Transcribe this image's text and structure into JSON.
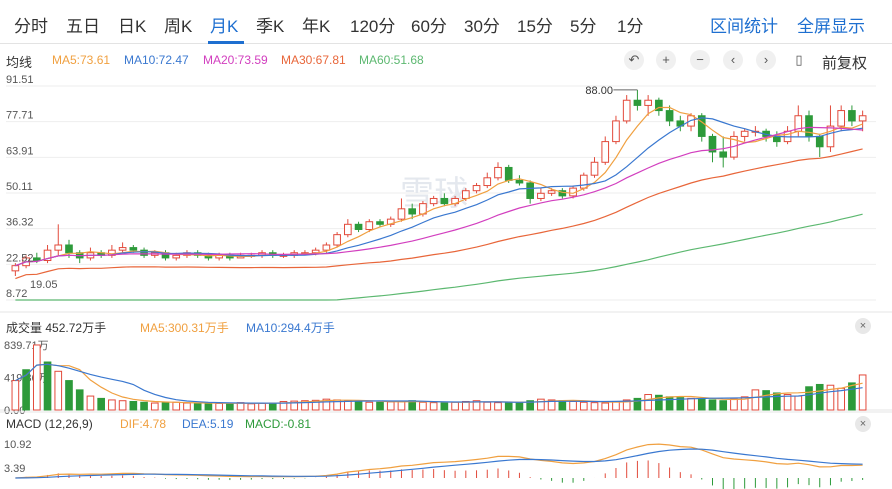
{
  "tabs": [
    "分时",
    "五日",
    "日K",
    "周K",
    "月K",
    "季K",
    "年K",
    "120分",
    "60分",
    "30分",
    "15分",
    "5分",
    "1分"
  ],
  "active_tab": "月K",
  "right_links": {
    "stats": "区间统计",
    "fullscreen": "全屏显示"
  },
  "toolbar": {
    "adjust": "前复权"
  },
  "ma_legend": {
    "title": "均线",
    "ma5": "MA5:73.61",
    "ma10": "MA10:72.47",
    "ma20": "MA20:73.59",
    "ma30": "MA30:67.81",
    "ma60": "MA60:51.68"
  },
  "volume_legend": {
    "title": "成交量",
    "value": "452.72万手",
    "ma5": "MA5:300.31万手",
    "ma10": "MA10:294.4万手"
  },
  "macd_legend": {
    "title": "MACD (12,26,9)",
    "dif": "DIF:4.78",
    "dea": "DEA:5.19",
    "macd": "MACD:-0.81"
  },
  "watermark": "雪球",
  "colors": {
    "up": "#e24a3b",
    "down": "#2d9a3a",
    "accent": "#1e6fd0",
    "ma5": "#f0a040",
    "ma10": "#3a78d0",
    "ma20": "#d23fbf",
    "ma30": "#e8663a",
    "ma60": "#5cb870"
  },
  "chart_data": [
    {
      "type": "candlestick",
      "title": "",
      "y_ticks": [
        "91.51",
        "77.71",
        "63.91",
        "50.11",
        "36.32",
        "22.52",
        "8.72"
      ],
      "ylim": [
        8.72,
        91.51
      ],
      "annotations": {
        "max": "88.00",
        "min": "19.05"
      },
      "candles": [
        [
          20,
          22,
          18,
          23
        ],
        [
          22,
          25,
          21,
          26
        ],
        [
          25,
          24,
          23,
          27
        ],
        [
          24,
          28,
          23,
          30
        ],
        [
          28,
          30,
          26,
          38
        ],
        [
          30,
          27,
          25,
          32
        ],
        [
          27,
          25,
          23,
          28
        ],
        [
          25,
          27,
          24,
          29
        ],
        [
          27,
          26,
          25,
          28
        ],
        [
          26,
          28,
          25,
          30
        ],
        [
          28,
          29,
          27,
          31
        ],
        [
          29,
          28,
          27,
          30
        ],
        [
          28,
          26,
          25,
          29
        ],
        [
          26,
          27,
          25,
          28
        ],
        [
          27,
          25,
          24,
          28
        ],
        [
          25,
          26,
          24,
          27
        ],
        [
          26,
          27,
          25,
          28
        ],
        [
          27,
          26,
          25,
          28
        ],
        [
          26,
          25,
          24,
          27
        ],
        [
          25,
          26,
          24,
          27
        ],
        [
          26,
          25,
          24,
          27
        ],
        [
          25,
          26,
          25,
          27
        ],
        [
          26,
          26,
          25,
          27
        ],
        [
          26,
          27,
          25,
          28
        ],
        [
          27,
          26,
          25,
          28
        ],
        [
          26,
          26,
          25,
          27
        ],
        [
          26,
          27,
          25,
          28
        ],
        [
          27,
          27,
          26,
          28
        ],
        [
          27,
          28,
          26,
          29
        ],
        [
          28,
          30,
          27,
          31
        ],
        [
          30,
          34,
          29,
          35
        ],
        [
          34,
          38,
          33,
          40
        ],
        [
          38,
          36,
          35,
          39
        ],
        [
          36,
          39,
          35,
          40
        ],
        [
          39,
          38,
          37,
          40
        ],
        [
          38,
          40,
          37,
          41
        ],
        [
          40,
          44,
          39,
          48
        ],
        [
          44,
          42,
          40,
          46
        ],
        [
          42,
          46,
          41,
          47
        ],
        [
          46,
          48,
          45,
          49
        ],
        [
          48,
          46,
          45,
          50
        ],
        [
          46,
          48,
          45,
          49
        ],
        [
          48,
          51,
          47,
          52
        ],
        [
          51,
          53,
          50,
          54
        ],
        [
          53,
          56,
          52,
          58
        ],
        [
          56,
          60,
          55,
          62
        ],
        [
          60,
          55,
          54,
          61
        ],
        [
          55,
          54,
          53,
          57
        ],
        [
          54,
          48,
          46,
          55
        ],
        [
          48,
          50,
          47,
          52
        ],
        [
          50,
          51,
          49,
          52
        ],
        [
          51,
          49,
          48,
          52
        ],
        [
          49,
          52,
          48,
          53
        ],
        [
          52,
          57,
          51,
          58
        ],
        [
          57,
          62,
          56,
          64
        ],
        [
          62,
          70,
          61,
          72
        ],
        [
          70,
          78,
          69,
          80
        ],
        [
          78,
          86,
          77,
          88
        ],
        [
          86,
          84,
          82,
          90
        ],
        [
          84,
          86,
          80,
          88
        ],
        [
          86,
          82,
          80,
          87
        ],
        [
          82,
          78,
          76,
          84
        ],
        [
          78,
          76,
          74,
          80
        ],
        [
          76,
          80,
          74,
          81
        ],
        [
          80,
          72,
          70,
          81
        ],
        [
          72,
          66,
          62,
          73
        ],
        [
          66,
          64,
          60,
          72
        ],
        [
          64,
          72,
          63,
          74
        ],
        [
          72,
          74,
          70,
          75
        ],
        [
          74,
          74,
          72,
          76
        ],
        [
          74,
          72,
          70,
          75
        ],
        [
          72,
          70,
          68,
          74
        ],
        [
          70,
          74,
          69,
          76
        ],
        [
          74,
          80,
          72,
          84
        ],
        [
          80,
          72,
          70,
          82
        ],
        [
          72,
          68,
          64,
          73
        ],
        [
          68,
          76,
          66,
          84
        ],
        [
          76,
          82,
          74,
          84
        ],
        [
          82,
          78,
          76,
          84
        ],
        [
          78,
          80,
          74,
          82
        ]
      ]
    },
    {
      "type": "bar",
      "title": "",
      "y_ticks": [
        "839.71万",
        "419.86万",
        "0.00"
      ],
      "ylim": [
        0,
        839.71
      ],
      "values": [
        380,
        520,
        840,
        620,
        500,
        380,
        260,
        180,
        150,
        130,
        120,
        110,
        100,
        90,
        95,
        100,
        90,
        85,
        80,
        85,
        90,
        95,
        80,
        85,
        90,
        110,
        115,
        120,
        125,
        140,
        130,
        120,
        110,
        100,
        100,
        105,
        110,
        120,
        100,
        95,
        90,
        100,
        110,
        120,
        100,
        95,
        90,
        100,
        120,
        140,
        130,
        120,
        110,
        100,
        95,
        90,
        110,
        130,
        150,
        200,
        190,
        170,
        160,
        150,
        140,
        130,
        120,
        140,
        170,
        260,
        250,
        220,
        200,
        180,
        300,
        330,
        320,
        280,
        350,
        452.72
      ],
      "up": [
        1,
        0,
        1,
        0,
        1,
        0,
        0,
        1,
        0,
        1,
        1,
        0,
        0,
        1,
        0,
        1,
        1,
        0,
        0,
        1,
        0,
        1,
        1,
        1,
        0,
        1,
        1,
        1,
        1,
        1,
        1,
        1,
        0,
        1,
        0,
        1,
        1,
        0,
        1,
        1,
        0,
        1,
        1,
        1,
        1,
        1,
        0,
        0,
        0,
        1,
        1,
        0,
        1,
        1,
        1,
        1,
        1,
        1,
        0,
        1,
        0,
        0,
        0,
        1,
        0,
        0,
        0,
        1,
        1,
        1,
        0,
        0,
        1,
        1,
        0,
        0,
        1,
        1,
        0,
        1
      ],
      "ma5_label": "MA5",
      "ma10_label": "MA10"
    },
    {
      "type": "macd",
      "title": "",
      "y_ticks": [
        "10.92",
        "3.39"
      ],
      "ylim": [
        -1,
        14
      ]
    }
  ]
}
